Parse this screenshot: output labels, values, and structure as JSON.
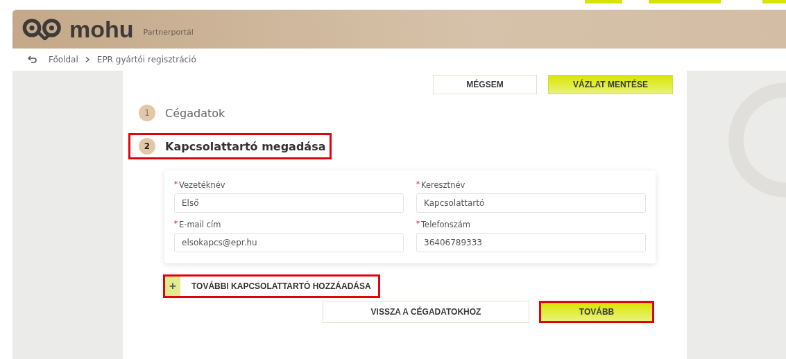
{
  "header": {
    "logo": "mohu",
    "subtitle": "Partnerportál"
  },
  "breadcrumb": [
    {
      "label": "Főoldal"
    },
    {
      "label": "EPR gyártói regisztráció"
    }
  ],
  "top_buttons": [
    {
      "label": "MÉGSEM",
      "kind": "secondary"
    },
    {
      "label": "VÁZLAT MENTÉSE",
      "kind": "primary"
    }
  ],
  "steps": [
    {
      "number": "1",
      "label": "Cégadatok",
      "active": false,
      "highlighted": false
    },
    {
      "number": "2",
      "label": "Kapcsolattartó megadása",
      "active": true,
      "highlighted": true
    }
  ],
  "fields": [
    {
      "label": "Vezetéknév",
      "required": true,
      "value": "Első"
    },
    {
      "label": "Keresztnév",
      "required": true,
      "value": "Kapcsolattartó"
    },
    {
      "label": "E-mail cím",
      "required": true,
      "value": "elsokapcs@epr.hu"
    },
    {
      "label": "Telefonszám",
      "required": true,
      "value": "36406789333"
    }
  ],
  "add_contact": {
    "icon": "+",
    "label": "TOVÁBBI KAPCSOLATTARTÓ HOZZÁADÁSA",
    "highlighted": true
  },
  "bottom_buttons": [
    {
      "label": "VISSZA A CÉGADATOKHOZ",
      "kind": "secondary",
      "highlighted": false
    },
    {
      "label": "TOVÁBB",
      "kind": "primary",
      "highlighted": true
    }
  ]
}
